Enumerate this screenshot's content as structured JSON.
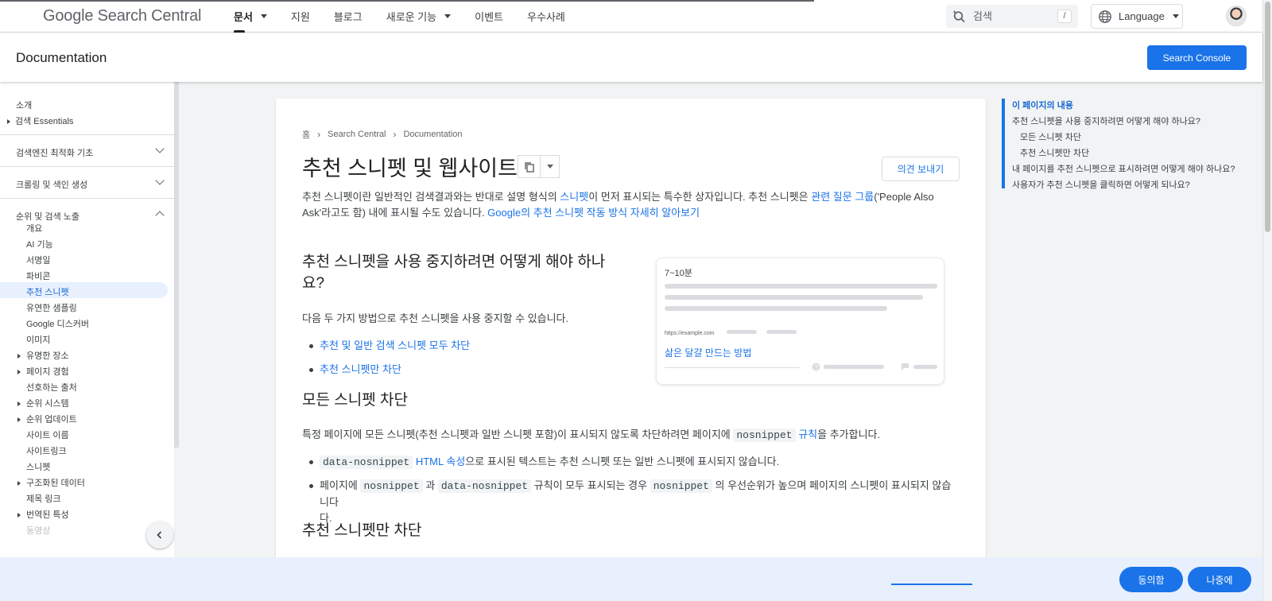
{
  "header": {
    "logo": "Google Search Central",
    "nav": [
      {
        "label": "문서",
        "caret": true,
        "active": true
      },
      {
        "label": "지원",
        "caret": false
      },
      {
        "label": "블로그",
        "caret": false
      },
      {
        "label": "새로운 기능",
        "caret": true
      },
      {
        "label": "이벤트",
        "caret": false
      },
      {
        "label": "우수사례",
        "caret": false
      }
    ],
    "search_placeholder": "검색",
    "search_shortcut": "/",
    "language": "Language"
  },
  "docbar": {
    "title": "Documentation",
    "search_console": "Search Console"
  },
  "sidebar": {
    "intro": "소개",
    "essentials": "검색 Essentials",
    "seo_basics": "검색엔진 최적화 기초",
    "crawling": "크롤링 및 색인 생성",
    "ranking": "순위 및 검색 노출",
    "items": [
      {
        "label": "개요",
        "expandable": false
      },
      {
        "label": "AI 기능",
        "expandable": false
      },
      {
        "label": "서명일",
        "expandable": false
      },
      {
        "label": "파비콘",
        "expandable": false
      },
      {
        "label": "추천 스니펫",
        "expandable": false,
        "active": true
      },
      {
        "label": "유연한 샘플링",
        "expandable": false
      },
      {
        "label": "Google 디스커버",
        "expandable": false
      },
      {
        "label": "이미지",
        "expandable": false
      },
      {
        "label": "유명한 장소",
        "expandable": true
      },
      {
        "label": "페이지 경험",
        "expandable": true
      },
      {
        "label": "선호하는 출처",
        "expandable": false
      },
      {
        "label": "순위 시스템",
        "expandable": true
      },
      {
        "label": "순위 업데이트",
        "expandable": true
      },
      {
        "label": "사이트 이름",
        "expandable": false
      },
      {
        "label": "사이트링크",
        "expandable": false
      },
      {
        "label": "스니펫",
        "expandable": false
      },
      {
        "label": "구조화된 데이터",
        "expandable": true
      },
      {
        "label": "제목 링크",
        "expandable": false
      },
      {
        "label": "번역된 특성",
        "expandable": true
      },
      {
        "label": "동영상",
        "expandable": false
      }
    ]
  },
  "article": {
    "breadcrumb": [
      "홈",
      "Search Central",
      "Documentation"
    ],
    "title": "추천 스니펫 및 웹사이트",
    "feedback": "의견 보내기",
    "intro": {
      "t1": "추천 스니펫이란 일반적인 검색결과와는 반대로 설명 형식의 ",
      "l1": "스니펫",
      "t2": "이 먼저 표시되는 특수한 상자입니다. 추천 스니펫은 ",
      "l2": "관련 질문 그룹",
      "t3": "('People Also",
      "t4": "Ask'라고도 함) 내에 표시될 수도 있습니다. ",
      "l3": "Google의 추천 스니펫 작동 방식 자세히 알아보기"
    },
    "h2_optout_line1": "추천 스니펫을 사용 중지하려면 어떻게 해야 하나",
    "h2_optout_line2": "요?",
    "optout_para": "다음 두 가지 방법으로 추천 스니펫을 사용 중지할 수 있습니다.",
    "optout_links": [
      "추천 및 일반 검색 스니펫 모두 차단",
      "추천 스니펫만 차단"
    ],
    "h2_all": "모든 스니펫 차단",
    "all_para": {
      "t1": "특정 페이지에 모든 스니펫(추천 스니펫과 일반 스니펫 포함)이 표시되지 않도록 차단하려면 페이지에 ",
      "code": "nosnippet",
      "link": "규칙",
      "t2": "을 추가합니다."
    },
    "all_b1": {
      "code": "data-nosnippet",
      "link": "HTML 속성",
      "text": "으로 표시된 텍스트는 추천 스니펫 또는 일반 스니펫에 표시되지 않습니다."
    },
    "all_b2": {
      "t1": "페이지에 ",
      "c1": "nosnippet",
      "t2": " 과 ",
      "c2": "data-nosnippet",
      "t3": " 규칙이 모두 표시되는 경우 ",
      "c3": "nosnippet",
      "t4": " 의 우선순위가 높으며 페이지의 스니펫이 표시되지 않습니다",
      "t5": "다."
    },
    "h2_featured": "추천 스니펫만 차단",
    "illustration": {
      "header": "7~10분",
      "url": "https://example.com",
      "link": "삶은 달걀 만드는 방법"
    }
  },
  "toc": {
    "title": "이 페이지의 내용",
    "items": [
      {
        "label": "추천 스니펫을 사용 중지하려면 어떻게 해야 하나요?",
        "indent": false
      },
      {
        "label": "모든 스니펫 차단",
        "indent": true
      },
      {
        "label": "추천 스니펫만 차단",
        "indent": true
      },
      {
        "label": "내 페이지를 추천 스니펫으로 표시하려면 어떻게 해야 하나요?",
        "indent": false
      },
      {
        "label": "사용자가 추천 스니펫을 클릭하면 어떻게 되나요?",
        "indent": false
      }
    ]
  },
  "cookie": {
    "agree": "동의함",
    "later": "나중에"
  },
  "colors": {
    "accent": "#1a73e8",
    "active_bg": "#e8f0fe"
  }
}
